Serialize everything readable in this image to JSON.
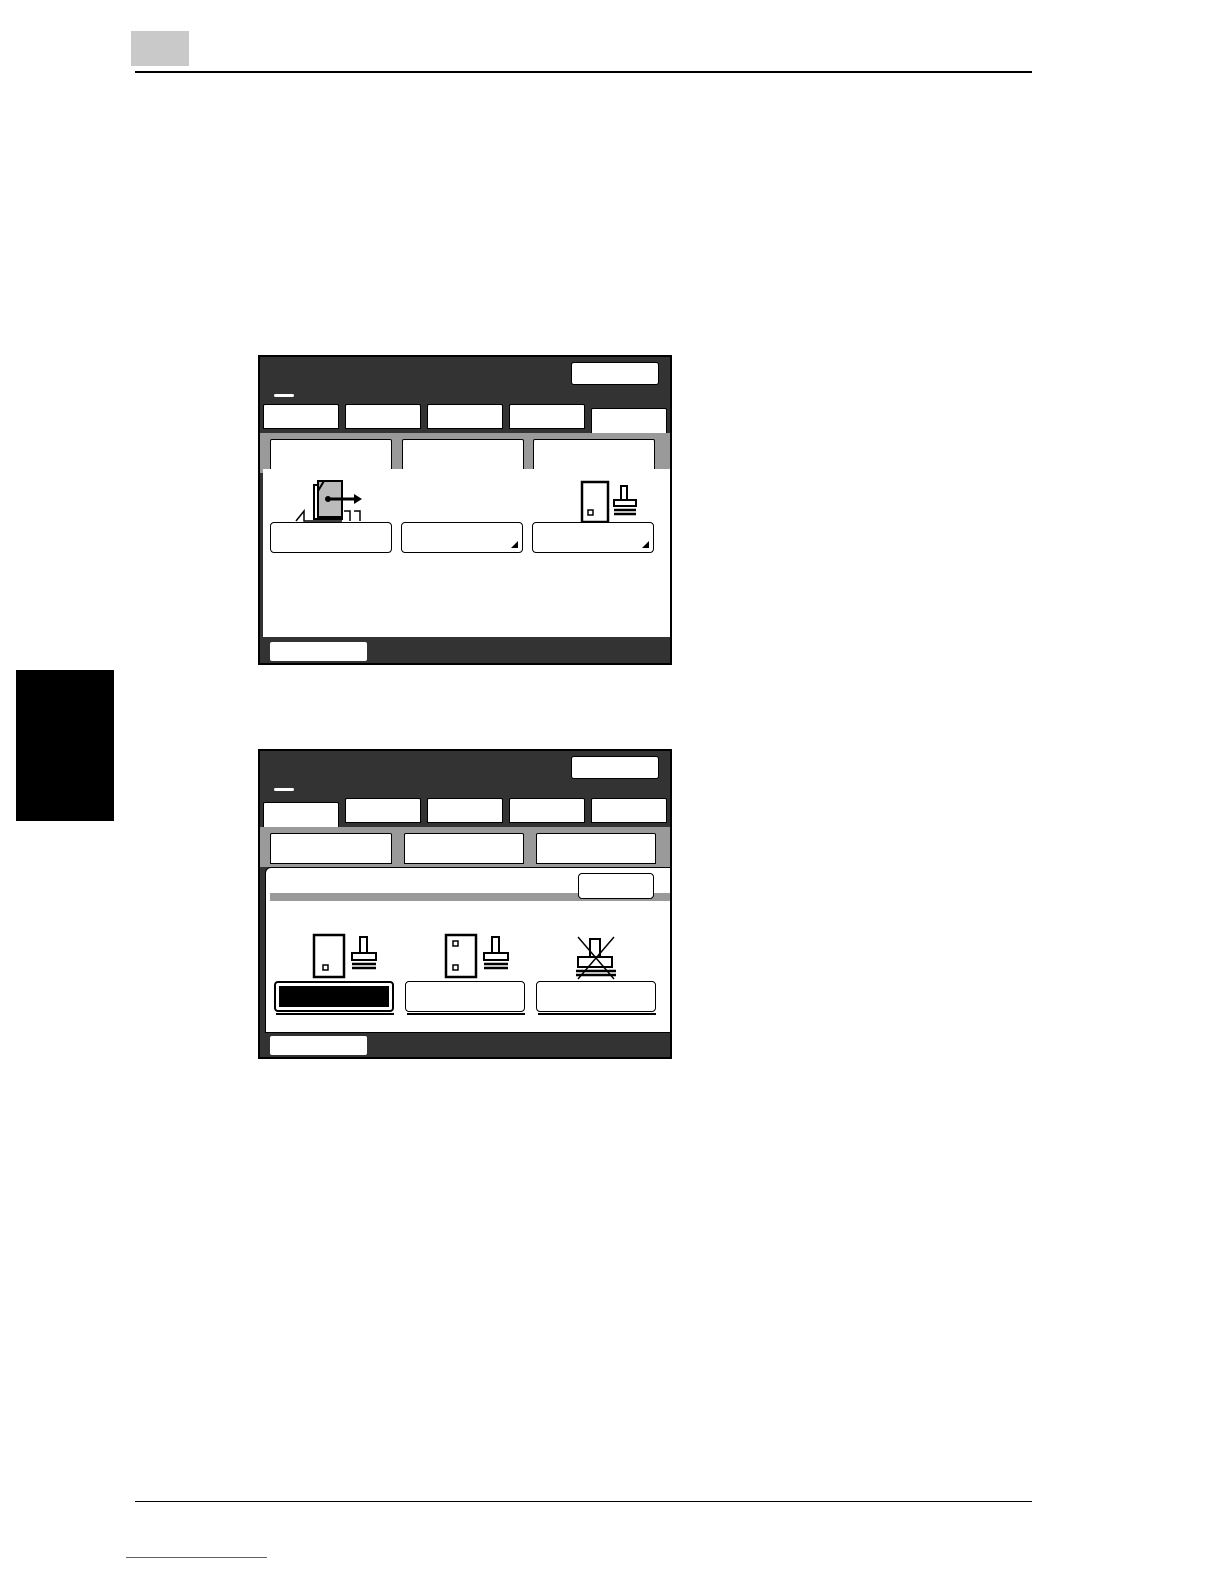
{
  "page": {
    "page_number": "",
    "section_tab": ""
  },
  "screen1": {
    "tabs": [
      "",
      "",
      "",
      "",
      ""
    ],
    "sub_tabs": [
      "",
      "",
      ""
    ],
    "buttons": [
      "",
      "",
      ""
    ],
    "icons": [
      "booklet-output-icon",
      "stamp-single-page-icon"
    ]
  },
  "screen2": {
    "tabs": [
      "",
      "",
      "",
      "",
      ""
    ],
    "sub_tabs": [
      "",
      "",
      ""
    ],
    "options": [
      "",
      "",
      ""
    ],
    "selected_option": 0,
    "icons": [
      "stamp-one-staple-icon",
      "stamp-two-staple-icon",
      "no-stamp-icon"
    ]
  }
}
